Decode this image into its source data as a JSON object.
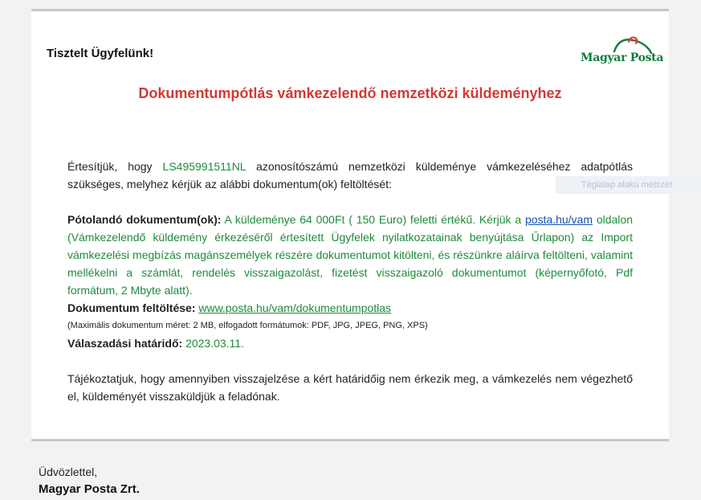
{
  "email": {
    "greeting": "Tisztelt Ügyfelünk!",
    "logo_text": "Magyar Posta",
    "title": "Dokumentumpótlás vámkezelendő nemzetközi küldeményhez",
    "p1_a": "Értesítjük, hogy ",
    "tracking_id": "LS495991511NL",
    "p1_b": " azonosítószámú nemzetközi küldeménye vámkezeléséhez adatpótlás szükséges, melyhez kérjük az alábbi dokumentum(ok) feltöltését:",
    "doc_label": "Pótolandó dokumentum(ok):",
    "doc_text_a": " A küldeménye 64 000Ft ( 150 Euro) feletti értékű. Kérjük a ",
    "doc_link": "posta.hu/vam",
    "doc_text_b": " oldalon (Vámkezelendő küldemény érkezéséről értesített Ügyfelek nyilatkozatainak benyújtása Űrlapon) az Import vámkezelési megbízás magánszemélyek részére dokumentumot kitölteni, és részünkre aláírva feltölteni, valamint mellékelni a számlát, rendelés visszaigazolást, fizetést visszaigazoló dokumentumot (képernyőfotó, Pdf formátum, 2 Mbyte alatt).",
    "upload_label": "Dokumentum feltöltése:",
    "upload_link": "www.posta.hu/vam/dokumentumpotlas",
    "limits_note": "(Maximális dokumentum méret: 2 MB, elfogadott formátumok: PDF, JPG, JPEG, PNG, XPS)",
    "deadline_label": "Válaszadási határidő:",
    "deadline_value": "2023.03.11.",
    "closing_paragraph": "Tájékoztatjuk, hogy amennyiben visszajelzése a kért határidőig nem érkezik meg, a vámkezelés nem végezhető el, küldeményét visszaküldjük a feladónak."
  },
  "overlay": {
    "tooltip_text": "Téglalap alakú metszet"
  },
  "footer": {
    "salutation": "Üdvözlettel,",
    "company": "Magyar Posta Zrt."
  },
  "colors": {
    "title_red": "#d03a33",
    "accent_green": "#1f8a3c",
    "link_blue": "#1a4fb5"
  },
  "icons": {
    "logo": "magyar-posta-horn-logo"
  }
}
